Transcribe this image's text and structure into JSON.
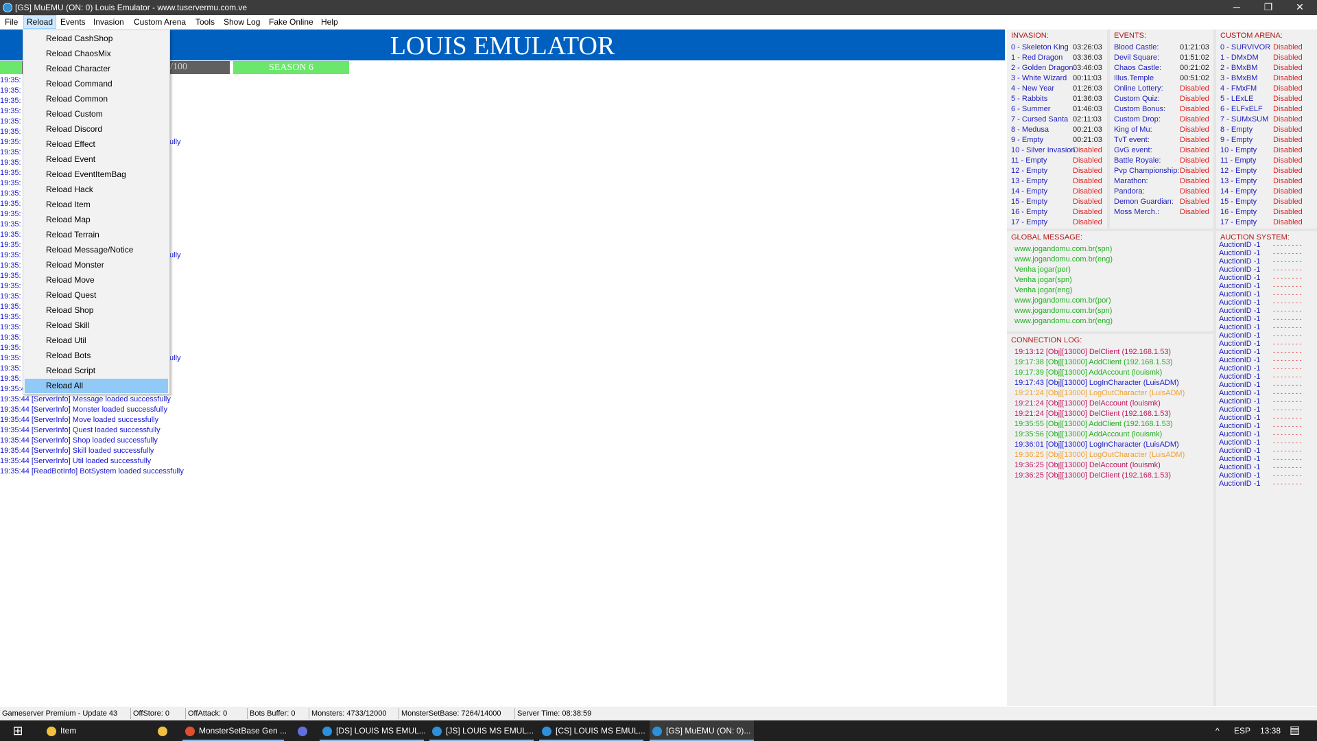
{
  "window": {
    "title": "[GS] MuEMU (ON: 0) Louis Emulator - www.tuservermu.com.ve",
    "minimize": "─",
    "maximize": "❐",
    "close": "✕"
  },
  "menu": [
    "File",
    "Reload",
    "Events",
    "Invasion",
    "Custom Arena",
    "Tools",
    "Show Log",
    "Fake Online",
    "Help"
  ],
  "header": {
    "title": "LOUIS EMULATOR",
    "online": "NE: 0/100",
    "season": "SEASON 6"
  },
  "reload_menu": [
    "Reload CashShop",
    "Reload ChaosMix",
    "Reload Character",
    "Reload Command",
    "Reload Common",
    "Reload Custom",
    "Reload Discord",
    "Reload Effect",
    "Reload Event",
    "Reload EventItemBag",
    "Reload Hack",
    "Reload Item",
    "Reload Map",
    "Reload Terrain",
    "Reload Message/Notice",
    "Reload Monster",
    "Reload Move",
    "Reload Quest",
    "Reload Shop",
    "Reload Skill",
    "Reload Util",
    "Reload Bots",
    "Reload Script",
    "Reload All"
  ],
  "reload_selected": "Reload All",
  "log_visible_prefixes": [
    "19:35:",
    "19:35:",
    "19:35:",
    "19:35:",
    "19:35:",
    "19:35:",
    "19:35:",
    "19:35:",
    "19:35:",
    "19:35:",
    "19:35:",
    "19:35:",
    "19:35:",
    "19:35:",
    "19:35:",
    "19:35:",
    "19:35:",
    "19:35:",
    "19:35:",
    "19:35:",
    "19:35:",
    "19:35:",
    "19:35:",
    "19:35:",
    "19:35:",
    "19:35:",
    "19:35:",
    "19:35:",
    "19:35:",
    "19:35:"
  ],
  "log_fragments": [
    "fully",
    "fully",
    "fully"
  ],
  "log_full": [
    "19:35:44 [ServerInfo] Map loaded successfully",
    "19:35:44 [ServerInfo] Message loaded successfully",
    "19:35:44 [ServerInfo] Monster loaded successfully",
    "19:35:44 [ServerInfo] Move loaded successfully",
    "19:35:44 [ServerInfo] Quest loaded successfully",
    "19:35:44 [ServerInfo] Shop loaded successfully",
    "19:35:44 [ServerInfo] Skill loaded successfully",
    "19:35:44 [ServerInfo] Util loaded successfully",
    "19:35:44 [ReadBotInfo] BotSystem loaded successfully"
  ],
  "invasion": {
    "title": "INVASION:",
    "rows": [
      {
        "name": "0 - Skeleton King",
        "val": "03:26:03"
      },
      {
        "name": "1 - Red Dragon",
        "val": "03:36:03"
      },
      {
        "name": "2 - Golden Dragon",
        "val": "03:46:03"
      },
      {
        "name": "3 - White Wizard",
        "val": "00:11:03"
      },
      {
        "name": "4 - New Year",
        "val": "01:26:03"
      },
      {
        "name": "5 - Rabbits",
        "val": "01:36:03"
      },
      {
        "name": "6 - Summer",
        "val": "01:46:03"
      },
      {
        "name": "7 - Cursed Santa",
        "val": "02:11:03"
      },
      {
        "name": "8 - Medusa",
        "val": "00:21:03"
      },
      {
        "name": "9 - Empty",
        "val": "00:21:03"
      },
      {
        "name": "10 - Silver Invasion",
        "val": "Disabled"
      },
      {
        "name": "11 - Empty",
        "val": "Disabled"
      },
      {
        "name": "12 - Empty",
        "val": "Disabled"
      },
      {
        "name": "13 - Empty",
        "val": "Disabled"
      },
      {
        "name": "14 - Empty",
        "val": "Disabled"
      },
      {
        "name": "15 - Empty",
        "val": "Disabled"
      },
      {
        "name": "16 - Empty",
        "val": "Disabled"
      },
      {
        "name": "17 - Empty",
        "val": "Disabled"
      }
    ]
  },
  "events": {
    "title": "EVENTS:",
    "rows": [
      {
        "name": "Blood Castle:",
        "val": "01:21:03"
      },
      {
        "name": "Devil Square:",
        "val": "01:51:02"
      },
      {
        "name": "Chaos Castle:",
        "val": "00:21:02"
      },
      {
        "name": "Illus.Temple",
        "val": "00:51:02"
      },
      {
        "name": "Online Lottery:",
        "val": "Disabled"
      },
      {
        "name": "Custom Quiz:",
        "val": "Disabled"
      },
      {
        "name": "Custom Bonus:",
        "val": "Disabled"
      },
      {
        "name": "Custom Drop:",
        "val": "Disabled"
      },
      {
        "name": "King of Mu:",
        "val": "Disabled"
      },
      {
        "name": "TvT event:",
        "val": "Disabled"
      },
      {
        "name": "GvG event:",
        "val": "Disabled"
      },
      {
        "name": "Battle Royale:",
        "val": "Disabled"
      },
      {
        "name": "Pvp Championship:",
        "val": "Disabled"
      },
      {
        "name": "Marathon:",
        "val": "Disabled"
      },
      {
        "name": "Pandora:",
        "val": "Disabled"
      },
      {
        "name": "Demon Guardian:",
        "val": "Disabled"
      },
      {
        "name": "Moss Merch.:",
        "val": "Disabled"
      }
    ]
  },
  "arena": {
    "title": "CUSTOM ARENA:",
    "rows": [
      {
        "name": "0 - SURVIVOR",
        "val": "Disabled"
      },
      {
        "name": "1 - DMxDM",
        "val": "Disabled"
      },
      {
        "name": "2 - BMxBM",
        "val": "Disabled"
      },
      {
        "name": "3 - BMxBM",
        "val": "Disabled"
      },
      {
        "name": "4 - FMxFM",
        "val": "Disabled"
      },
      {
        "name": "5 - LExLE",
        "val": "Disabled"
      },
      {
        "name": "6 - ELFxELF",
        "val": "Disabled"
      },
      {
        "name": "7 - SUMxSUM",
        "val": "Disabled"
      },
      {
        "name": "8 - Empty",
        "val": "Disabled"
      },
      {
        "name": "9 - Empty",
        "val": "Disabled"
      },
      {
        "name": "10 - Empty",
        "val": "Disabled"
      },
      {
        "name": "11 - Empty",
        "val": "Disabled"
      },
      {
        "name": "12 - Empty",
        "val": "Disabled"
      },
      {
        "name": "13 - Empty",
        "val": "Disabled"
      },
      {
        "name": "14 - Empty",
        "val": "Disabled"
      },
      {
        "name": "15 - Empty",
        "val": "Disabled"
      },
      {
        "name": "16 - Empty",
        "val": "Disabled"
      },
      {
        "name": "17 - Empty",
        "val": "Disabled"
      }
    ]
  },
  "global_message": {
    "title": "GLOBAL MESSAGE:",
    "rows": [
      "www.jogandomu.com.br(spn)",
      "www.jogandomu.com.br(eng)",
      "Venha jogar(por)",
      "Venha jogar(spn)",
      "Venha jogar(eng)",
      "www.jogandomu.com.br(por)",
      "www.jogandomu.com.br(spn)",
      "www.jogandomu.com.br(eng)"
    ]
  },
  "connection_log": {
    "title": "CONNECTION LOG:",
    "rows": [
      {
        "text": "19:13:12 [Obj][13000] DelClient (192.168.1.53)",
        "color": "#c01860"
      },
      {
        "text": "19:17:38 [Obj][13000] AddClient (192.168.1.53)",
        "color": "#20b020"
      },
      {
        "text": "19:17:39 [Obj][13000] AddAccount (louismk)",
        "color": "#20b020"
      },
      {
        "text": "19:17:43 [Obj][13000] LogInCharacter (LuisADM)",
        "color": "#2020d0"
      },
      {
        "text": "19:21:24 [Obj][13000] LogOutCharacter (LuisADM)",
        "color": "#f0a030"
      },
      {
        "text": "19:21:24 [Obj][13000] DelAccount (louismk)",
        "color": "#c01860"
      },
      {
        "text": "19:21:24 [Obj][13000] DelClient (192.168.1.53)",
        "color": "#c01860"
      },
      {
        "text": "19:35:55 [Obj][13000] AddClient (192.168.1.53)",
        "color": "#20b020"
      },
      {
        "text": "19:35:56 [Obj][13000] AddAccount (louismk)",
        "color": "#20b020"
      },
      {
        "text": "19:36:01 [Obj][13000] LogInCharacter (LuisADM)",
        "color": "#2020d0"
      },
      {
        "text": "19:36:25 [Obj][13000] LogOutCharacter (LuisADM)",
        "color": "#f0a030"
      },
      {
        "text": "19:36:25 [Obj][13000] DelAccount (louismk)",
        "color": "#c01860"
      },
      {
        "text": "19:36:25 [Obj][13000] DelClient (192.168.1.53)",
        "color": "#c01860"
      }
    ]
  },
  "auction": {
    "title": "AUCTION SYSTEM:",
    "label": "AuctionID -1",
    "value": "- - - - - - - -",
    "count": 30
  },
  "status": [
    "Gameserver Premium - Update 43",
    "OffStore: 0",
    "OffAttack: 0",
    "Bots Buffer: 0",
    "Monsters: 4733/12000",
    "MonsterSetBase: 7264/14000",
    "Server Time: 08:38:59"
  ],
  "taskbar": {
    "start_icon": "windows-start-icon",
    "items": [
      {
        "label": "Item",
        "icon": "folder-icon",
        "color": "#f0c040"
      },
      {
        "label": "",
        "icon": "calendar-icon",
        "color": "#f0c040"
      },
      {
        "label": "MonsterSetBase Gen ...",
        "icon": "chrome-icon",
        "color": "#e05030"
      },
      {
        "label": "",
        "icon": "discord-icon",
        "color": "#6070e0"
      },
      {
        "label": "[DS] LOUIS MS EMUL...",
        "icon": "mu-icon",
        "color": "#2f8fd8"
      },
      {
        "label": "[JS] LOUIS MS EMUL...",
        "icon": "mu-icon",
        "color": "#2f8fd8"
      },
      {
        "label": "[CS] LOUIS MS EMUL...",
        "icon": "mu-icon",
        "color": "#2f8fd8"
      },
      {
        "label": "[GS] MuEMU (ON: 0)...",
        "icon": "mu-icon",
        "color": "#2f8fd8"
      }
    ],
    "tray": {
      "chevron": "^",
      "lang": "ESP",
      "time": "13:38",
      "notif": "▤"
    }
  }
}
